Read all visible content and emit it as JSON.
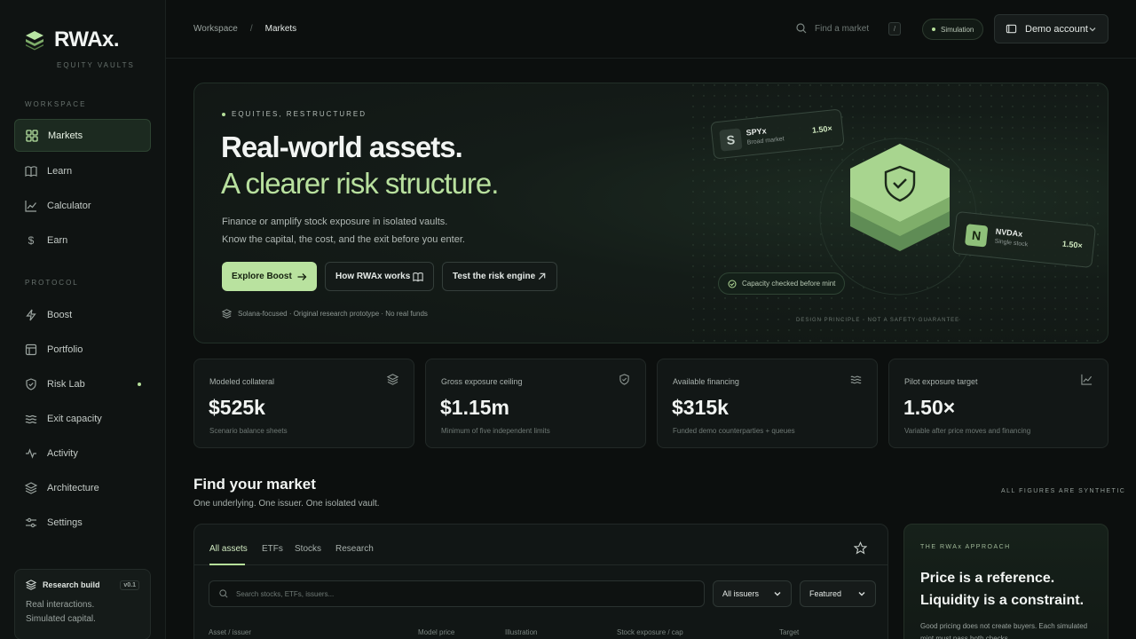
{
  "brand": {
    "name": "RWAx.",
    "tagline": "EQUITY VAULTS"
  },
  "sidebar": {
    "workspace_label": "WORKSPACE",
    "protocol_label": "PROTOCOL",
    "workspace_items": [
      {
        "label": "Markets",
        "icon": "grid-icon",
        "active": true
      },
      {
        "label": "Learn",
        "icon": "book-icon"
      },
      {
        "label": "Calculator",
        "icon": "chart-line-icon"
      },
      {
        "label": "Earn",
        "icon": "dollar-icon"
      }
    ],
    "protocol_items": [
      {
        "label": "Boost",
        "icon": "bolt-icon"
      },
      {
        "label": "Portfolio",
        "icon": "briefcase-icon"
      },
      {
        "label": "Risk Lab",
        "icon": "shield-icon",
        "dot": true
      },
      {
        "label": "Exit capacity",
        "icon": "waves-icon"
      },
      {
        "label": "Activity",
        "icon": "pulse-icon"
      },
      {
        "label": "Architecture",
        "icon": "layers-icon"
      },
      {
        "label": "Settings",
        "icon": "sliders-icon"
      }
    ],
    "research_build": {
      "title": "Research build",
      "version": "v0.1",
      "line1": "Real interactions.",
      "line2": "Simulated capital."
    }
  },
  "topbar": {
    "breadcrumb": [
      "Workspace",
      "Markets"
    ],
    "search_placeholder": "Find a market",
    "shortcut": "/",
    "mode_badge": "Simulation",
    "account_label": "Demo account"
  },
  "hero": {
    "eyebrow": "EQUITIES, RESTRUCTURED",
    "title_line1": "Real-world assets.",
    "title_line2": "A clearer risk structure.",
    "desc_line1": "Finance or amplify stock exposure in isolated vaults.",
    "desc_line2": "Know the capital, the cost, and the exit before you enter.",
    "btn_primary": "Explore Boost",
    "btn_secondary": "How RWAx works",
    "btn_tertiary": "Test the risk engine",
    "footnote": "Solana-focused · Original research prototype · No real funds",
    "design_note": "DESIGN PRINCIPLE · NOT A SAFETY GUARANTEE",
    "card_spy": {
      "letter": "S",
      "name": "SPYx",
      "sub": "Broad market",
      "value": "1.50×"
    },
    "card_nvda": {
      "letter": "N",
      "name": "NVDAx",
      "sub": "Single stock",
      "value": "1.50×"
    },
    "capacity_pill": "Capacity checked before mint"
  },
  "stats": [
    {
      "label": "Modeled collateral",
      "value": "$525k",
      "sub": "Scenario balance sheets",
      "icon": "layers-icon"
    },
    {
      "label": "Gross exposure ceiling",
      "value": "$1.15m",
      "sub": "Minimum of five independent limits",
      "icon": "shield-icon"
    },
    {
      "label": "Available financing",
      "value": "$315k",
      "sub": "Funded demo counterparties + queues",
      "icon": "waves-icon"
    },
    {
      "label": "Pilot exposure target",
      "value": "1.50×",
      "sub": "Variable after price moves and financing",
      "icon": "chart-line-icon"
    }
  ],
  "find": {
    "title": "Find your market",
    "subtitle": "One underlying. One issuer. One isolated vault.",
    "note": "ALL FIGURES ARE SYNTHETIC"
  },
  "markets": {
    "tabs": [
      "All assets",
      "ETFs",
      "Stocks",
      "Research"
    ],
    "search_placeholder": "Search stocks, ETFs, issuers...",
    "issuer_filter": "All issuers",
    "sort": "Featured",
    "columns": [
      "Asset / issuer",
      "Model price",
      "Illustration",
      "Stock exposure / cap",
      "Target"
    ]
  },
  "approach": {
    "eyebrow": "THE RWAx APPROACH",
    "line1": "Price is a reference.",
    "line2": "Liquidity is a constraint.",
    "desc": "Good pricing does not create buyers. Each simulated mint must pass both checks."
  }
}
